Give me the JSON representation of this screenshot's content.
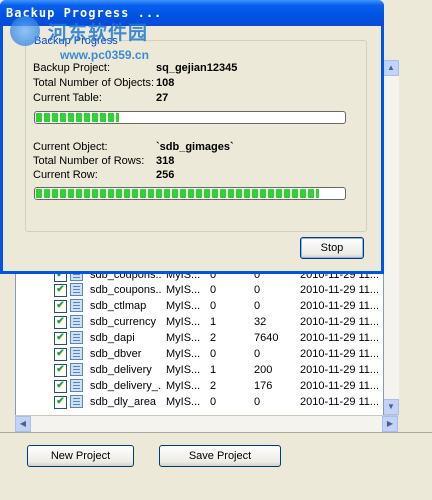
{
  "dialog": {
    "title": "Backup Progress ...",
    "group_label": "Backup Progress",
    "fields": [
      {
        "label": "Backup Project:",
        "value": "sq_gejian12345"
      },
      {
        "label": "Total Number of Objects:",
        "value": "108"
      },
      {
        "label": "Current Table:",
        "value": "27"
      },
      {
        "label": "Current Object:",
        "value": "`sdb_gimages`"
      },
      {
        "label": "Total Number of Rows:",
        "value": "318"
      },
      {
        "label": "Current Row:",
        "value": "256"
      }
    ],
    "progress_top": 0.27,
    "progress_bottom": 0.92,
    "stop_label": "Stop"
  },
  "watermark": {
    "text1": "河东软件园",
    "text2": "www.pc0359.cn"
  },
  "table": {
    "rows": [
      {
        "name": "sdb_coupons...",
        "type": "MyIS...",
        "a": "0",
        "b": "0",
        "date": "2010-11-29 11..."
      },
      {
        "name": "sdb_coupons...",
        "type": "MyIS...",
        "a": "0",
        "b": "0",
        "date": "2010-11-29 11..."
      },
      {
        "name": "sdb_ctlmap",
        "type": "MyIS...",
        "a": "0",
        "b": "0",
        "date": "2010-11-29 11..."
      },
      {
        "name": "sdb_currency",
        "type": "MyIS...",
        "a": "1",
        "b": "32",
        "date": "2010-11-29 11..."
      },
      {
        "name": "sdb_dapi",
        "type": "MyIS...",
        "a": "2",
        "b": "7640",
        "date": "2010-11-29 11..."
      },
      {
        "name": "sdb_dbver",
        "type": "MyIS...",
        "a": "0",
        "b": "0",
        "date": "2010-11-29 11..."
      },
      {
        "name": "sdb_delivery",
        "type": "MyIS...",
        "a": "1",
        "b": "200",
        "date": "2010-11-29 11..."
      },
      {
        "name": "sdb_delivery_...",
        "type": "MyIS...",
        "a": "2",
        "b": "176",
        "date": "2010-11-29 11..."
      },
      {
        "name": "sdb_dly_area",
        "type": "MyIS...",
        "a": "0",
        "b": "0",
        "date": "2010-11-29 11..."
      }
    ]
  },
  "buttons": {
    "new_project": "New Project",
    "save_project": "Save Project"
  },
  "colors": {
    "titlebar": "#0054e3",
    "progress_fill": "#2fd32f",
    "group_label": "#0046d5"
  }
}
